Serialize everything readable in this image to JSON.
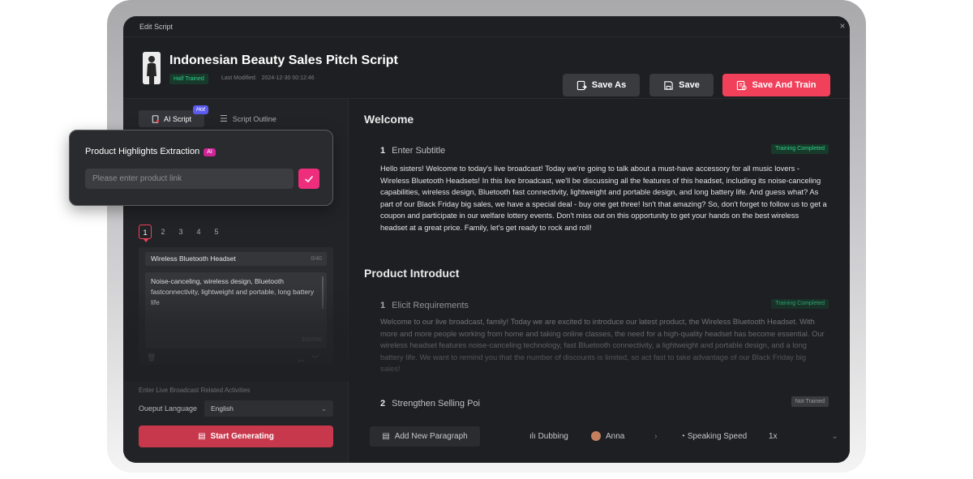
{
  "window": {
    "title": "Edit Script",
    "close": "×"
  },
  "header": {
    "title": "Indonesian Beauty Sales Pitch Script",
    "status_badge": "Half Trained",
    "last_modified_label": "Last Modified:",
    "last_modified_value": "2024-12-30 00:12:46",
    "buttons": {
      "save_as": "Save As",
      "save": "Save",
      "save_and_train": "Save And Train"
    }
  },
  "left": {
    "tabs": {
      "ai_script": "AI Script",
      "hot": "Hot",
      "outline": "Script Outline"
    },
    "popup": {
      "title": "Product Highlights Extraction",
      "ai_badge": "AI",
      "input_placeholder": "Please enter product link"
    },
    "pages": [
      "1",
      "2",
      "3",
      "4",
      "5"
    ],
    "product": {
      "name": "Wireless Bluetooth Headset",
      "name_count": "0/40",
      "description": "Noise-canceling, wireless design, Bluetooth fastconnectivity, lightweight and portable, long battery life",
      "desc_count": "320/500"
    },
    "enter_live": "Enter Live Broadcast Related Activities",
    "output_language_label": "Oueput Language",
    "output_language_value": "English",
    "start_generating": "Start Generating"
  },
  "right": {
    "sections": [
      {
        "title": "Welcome",
        "paragraphs": [
          {
            "num": "1",
            "heading": "Enter Subtitle",
            "status": "Training Completed",
            "text": "Hello sisters! Welcome to today's live broadcast! Today we're going to talk about a must-have accessory for all music lovers - Wireless Bluetooth Headsets! In this live broadcast, we'll be discussing all the features of this headset, including its noise-canceling capabilities, wireless design, Bluetooth fast connectivity, lightweight and portable design, and long battery life. And guess what? As part of our Black Friday big sales, we have a special deal - buy one get three! Isn't that amazing? So, don't forget to follow us to get a coupon and participate in our welfare lottery events. Don't miss out on this opportunity to get your hands on the best wireless headset at a great price. Family, let's get ready to rock and roll!"
          }
        ]
      },
      {
        "title": "Product Introduct",
        "paragraphs": [
          {
            "num": "1",
            "heading": "Elicit Requirements",
            "status": "Training Completed",
            "text": "Welcome to our live broadcast, family! Today we are excited to introduce our latest product, the Wireless Bluetooth Headset. With more and more people working from home and taking online classes, the need for a high-quality headset has become essential. Our wireless headset features noise-canceling technology, fast Bluetooth connectivity, a lightweight and portable design, and a long battery life. We want to remind you that the number of discounts is limited, so act fast to take advantage of our Black Friday big sales!"
          },
          {
            "num": "2",
            "heading": "Strengthen Selling Poi",
            "status": "Not Trained",
            "text": ""
          }
        ]
      }
    ],
    "bottom": {
      "add_paragraph": "Add New Paragraph",
      "dubbing": "Dubbing",
      "voice": "Anna",
      "speaking_speed": "Speaking Speed",
      "speed_value": "1x"
    }
  },
  "colors": {
    "accent": "#f0405a",
    "success": "#2fd08a",
    "popup_ai": "#d0259a",
    "confirm": "#ee2e7c"
  }
}
